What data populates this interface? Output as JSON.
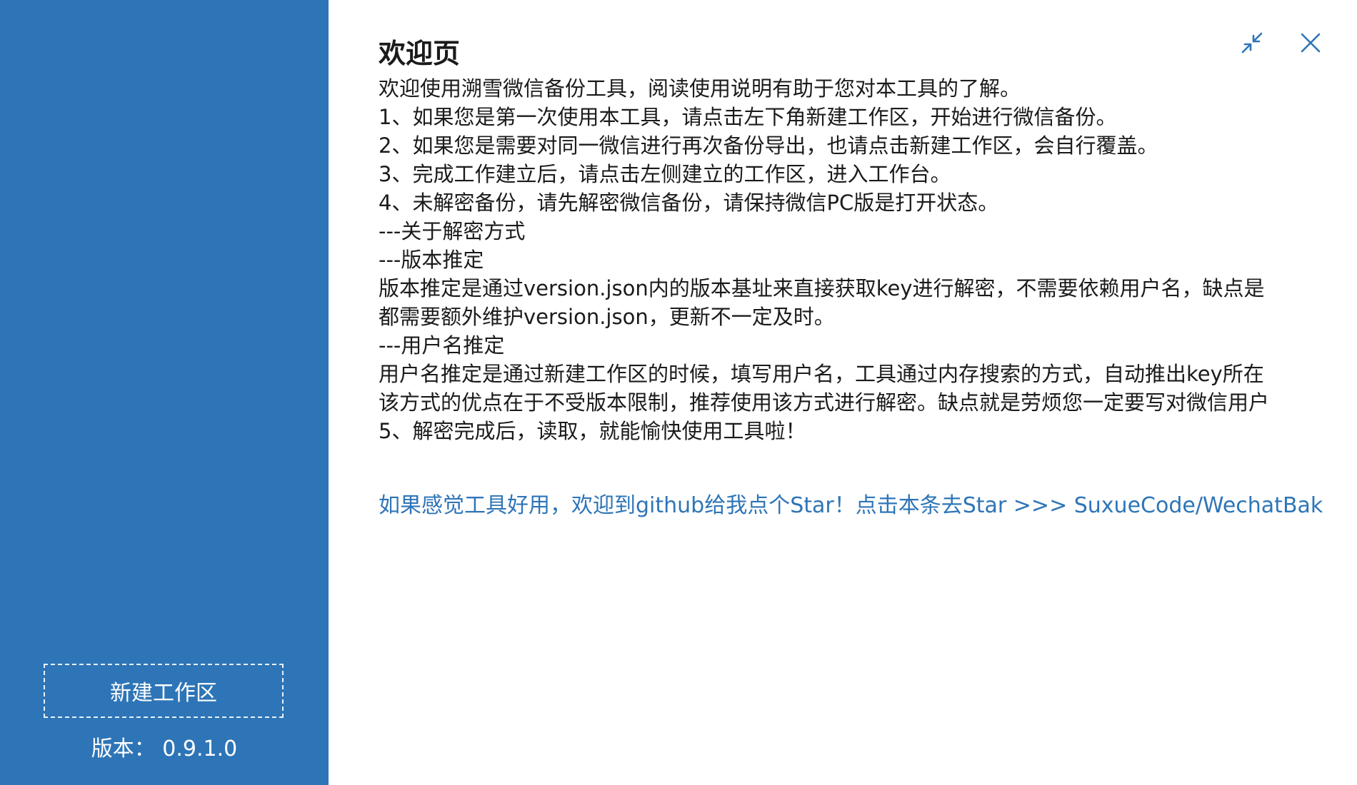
{
  "sidebar": {
    "new_workspace_label": "新建工作区",
    "version_label": "版本： 0.9.1.0"
  },
  "main": {
    "title": "欢迎页",
    "lines": [
      "欢迎使用溯雪微信备份工具，阅读使用说明有助于您对本工具的了解。",
      "1、如果您是第一次使用本工具，请点击左下角新建工作区，开始进行微信备份。",
      "2、如果您是需要对同一微信进行再次备份导出，也请点击新建工作区，会自行覆盖。",
      "3、完成工作建立后，请点击左侧建立的工作区，进入工作台。",
      "4、未解密备份，请先解密微信备份，请保持微信PC版是打开状态。",
      "---关于解密方式",
      "---版本推定",
      "版本推定是通过version.json内的版本基址来直接获取key进行解密，不需要依赖用户名，缺点是",
      "都需要额外维护version.json，更新不一定及时。",
      "---用户名推定",
      "用户名推定是通过新建工作区的时候，填写用户名，工具通过内存搜索的方式，自动推出key所在",
      "该方式的优点在于不受版本限制，推荐使用该方式进行解密。缺点就是劳烦您一定要写对微信用户",
      "5、解密完成后，读取，就能愉快使用工具啦！"
    ],
    "star_link": "如果感觉工具好用，欢迎到github给我点个Star！点击本条去Star >>> SuxueCode/WechatBak"
  },
  "icons": {
    "minimize": "collapse-arrows-icon",
    "close": "close-icon"
  },
  "colors": {
    "sidebar_bg": "#2e75b7",
    "accent": "#2e75b7",
    "text": "#1b1b1b"
  }
}
